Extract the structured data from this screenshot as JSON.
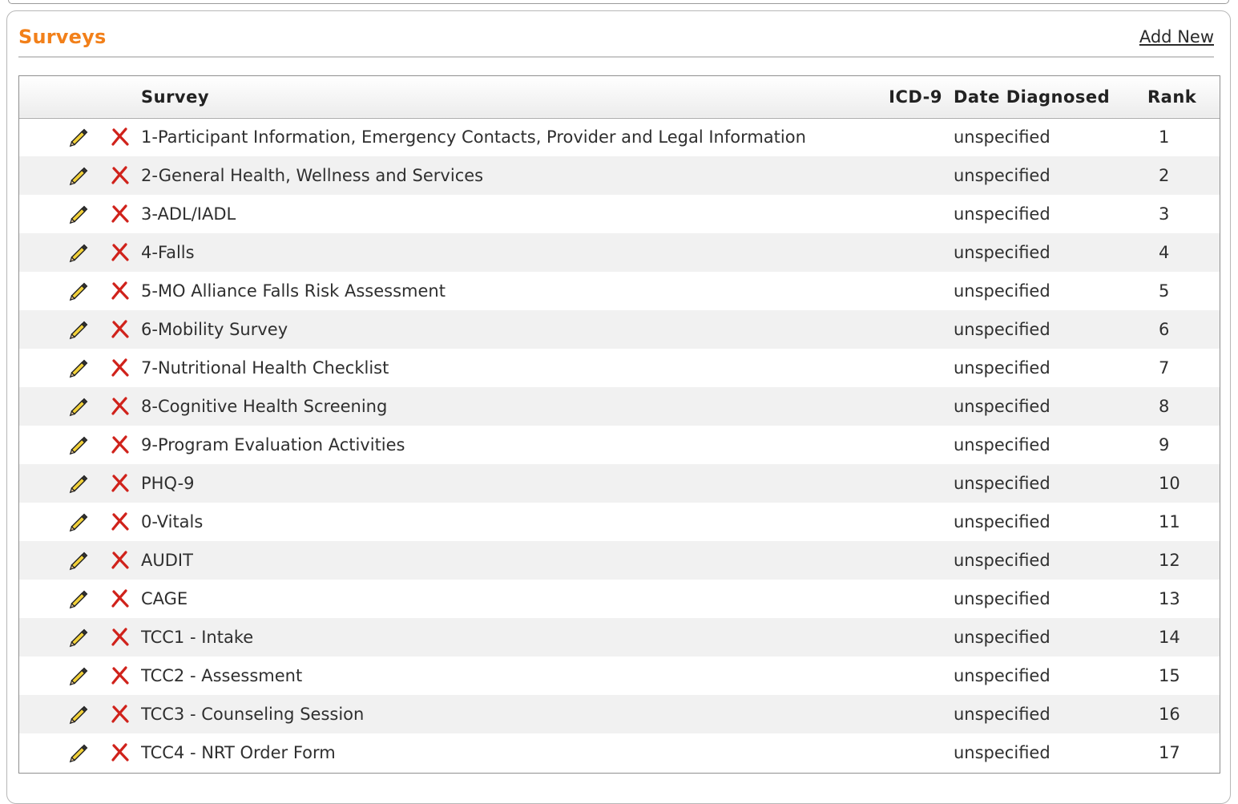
{
  "panel": {
    "title": "Surveys",
    "add_new_label": "Add New"
  },
  "icons": {
    "edit": "pencil-icon",
    "delete": "red-x-icon"
  },
  "colors": {
    "title": "#f2801a",
    "delete": "#d0221b",
    "row_alt": "#f1f1f1"
  },
  "table": {
    "headers": {
      "survey": "Survey",
      "icd9": "ICD-9",
      "date_diagnosed": "Date Diagnosed",
      "rank": "Rank"
    },
    "rows": [
      {
        "survey": "1-Participant Information, Emergency Contacts, Provider and Legal Information",
        "icd9": "",
        "date": "unspecified",
        "rank": "1"
      },
      {
        "survey": "2-General Health, Wellness and Services",
        "icd9": "",
        "date": "unspecified",
        "rank": "2"
      },
      {
        "survey": "3-ADL/IADL",
        "icd9": "",
        "date": "unspecified",
        "rank": "3"
      },
      {
        "survey": "4-Falls",
        "icd9": "",
        "date": "unspecified",
        "rank": "4"
      },
      {
        "survey": "5-MO Alliance Falls Risk Assessment",
        "icd9": "",
        "date": "unspecified",
        "rank": "5"
      },
      {
        "survey": "6-Mobility Survey",
        "icd9": "",
        "date": "unspecified",
        "rank": "6"
      },
      {
        "survey": "7-Nutritional Health Checklist",
        "icd9": "",
        "date": "unspecified",
        "rank": "7"
      },
      {
        "survey": "8-Cognitive Health Screening",
        "icd9": "",
        "date": "unspecified",
        "rank": "8"
      },
      {
        "survey": "9-Program Evaluation Activities",
        "icd9": "",
        "date": "unspecified",
        "rank": "9"
      },
      {
        "survey": "PHQ-9",
        "icd9": "",
        "date": "unspecified",
        "rank": "10"
      },
      {
        "survey": "0-Vitals",
        "icd9": "",
        "date": "unspecified",
        "rank": "11"
      },
      {
        "survey": "AUDIT",
        "icd9": "",
        "date": "unspecified",
        "rank": "12"
      },
      {
        "survey": "CAGE",
        "icd9": "",
        "date": "unspecified",
        "rank": "13"
      },
      {
        "survey": "TCC1 - Intake",
        "icd9": "",
        "date": "unspecified",
        "rank": "14"
      },
      {
        "survey": "TCC2 - Assessment",
        "icd9": "",
        "date": "unspecified",
        "rank": "15"
      },
      {
        "survey": "TCC3 - Counseling Session",
        "icd9": "",
        "date": "unspecified",
        "rank": "16"
      },
      {
        "survey": "TCC4 - NRT Order Form",
        "icd9": "",
        "date": "unspecified",
        "rank": "17"
      }
    ]
  }
}
